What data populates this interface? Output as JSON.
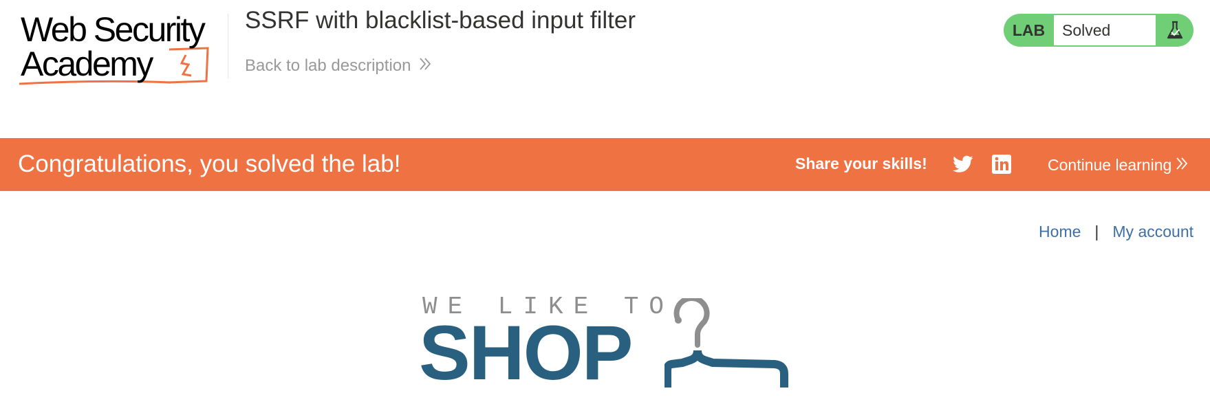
{
  "header": {
    "logo_line1": "Web Security",
    "logo_line2": "Academy",
    "lab_title": "SSRF with blacklist-based input filter",
    "back_link": "Back to lab description"
  },
  "lab_status": {
    "tag": "LAB",
    "status": "Solved",
    "icon": "flask-icon",
    "color": "#70ce76"
  },
  "banner": {
    "message": "Congratulations, you solved the lab!",
    "share_label": "Share your skills!",
    "share_icons": [
      "twitter-icon",
      "linkedin-icon"
    ],
    "continue_label": "Continue learning",
    "color": "#ef7243"
  },
  "nav": {
    "items": [
      {
        "label": "Home"
      },
      {
        "label": "My account"
      }
    ],
    "separator": "|"
  },
  "shop_logo": {
    "tagline": "WE LIKE TO",
    "word": "SHOP",
    "icon": "hanger-icon",
    "color": "#29607f"
  }
}
